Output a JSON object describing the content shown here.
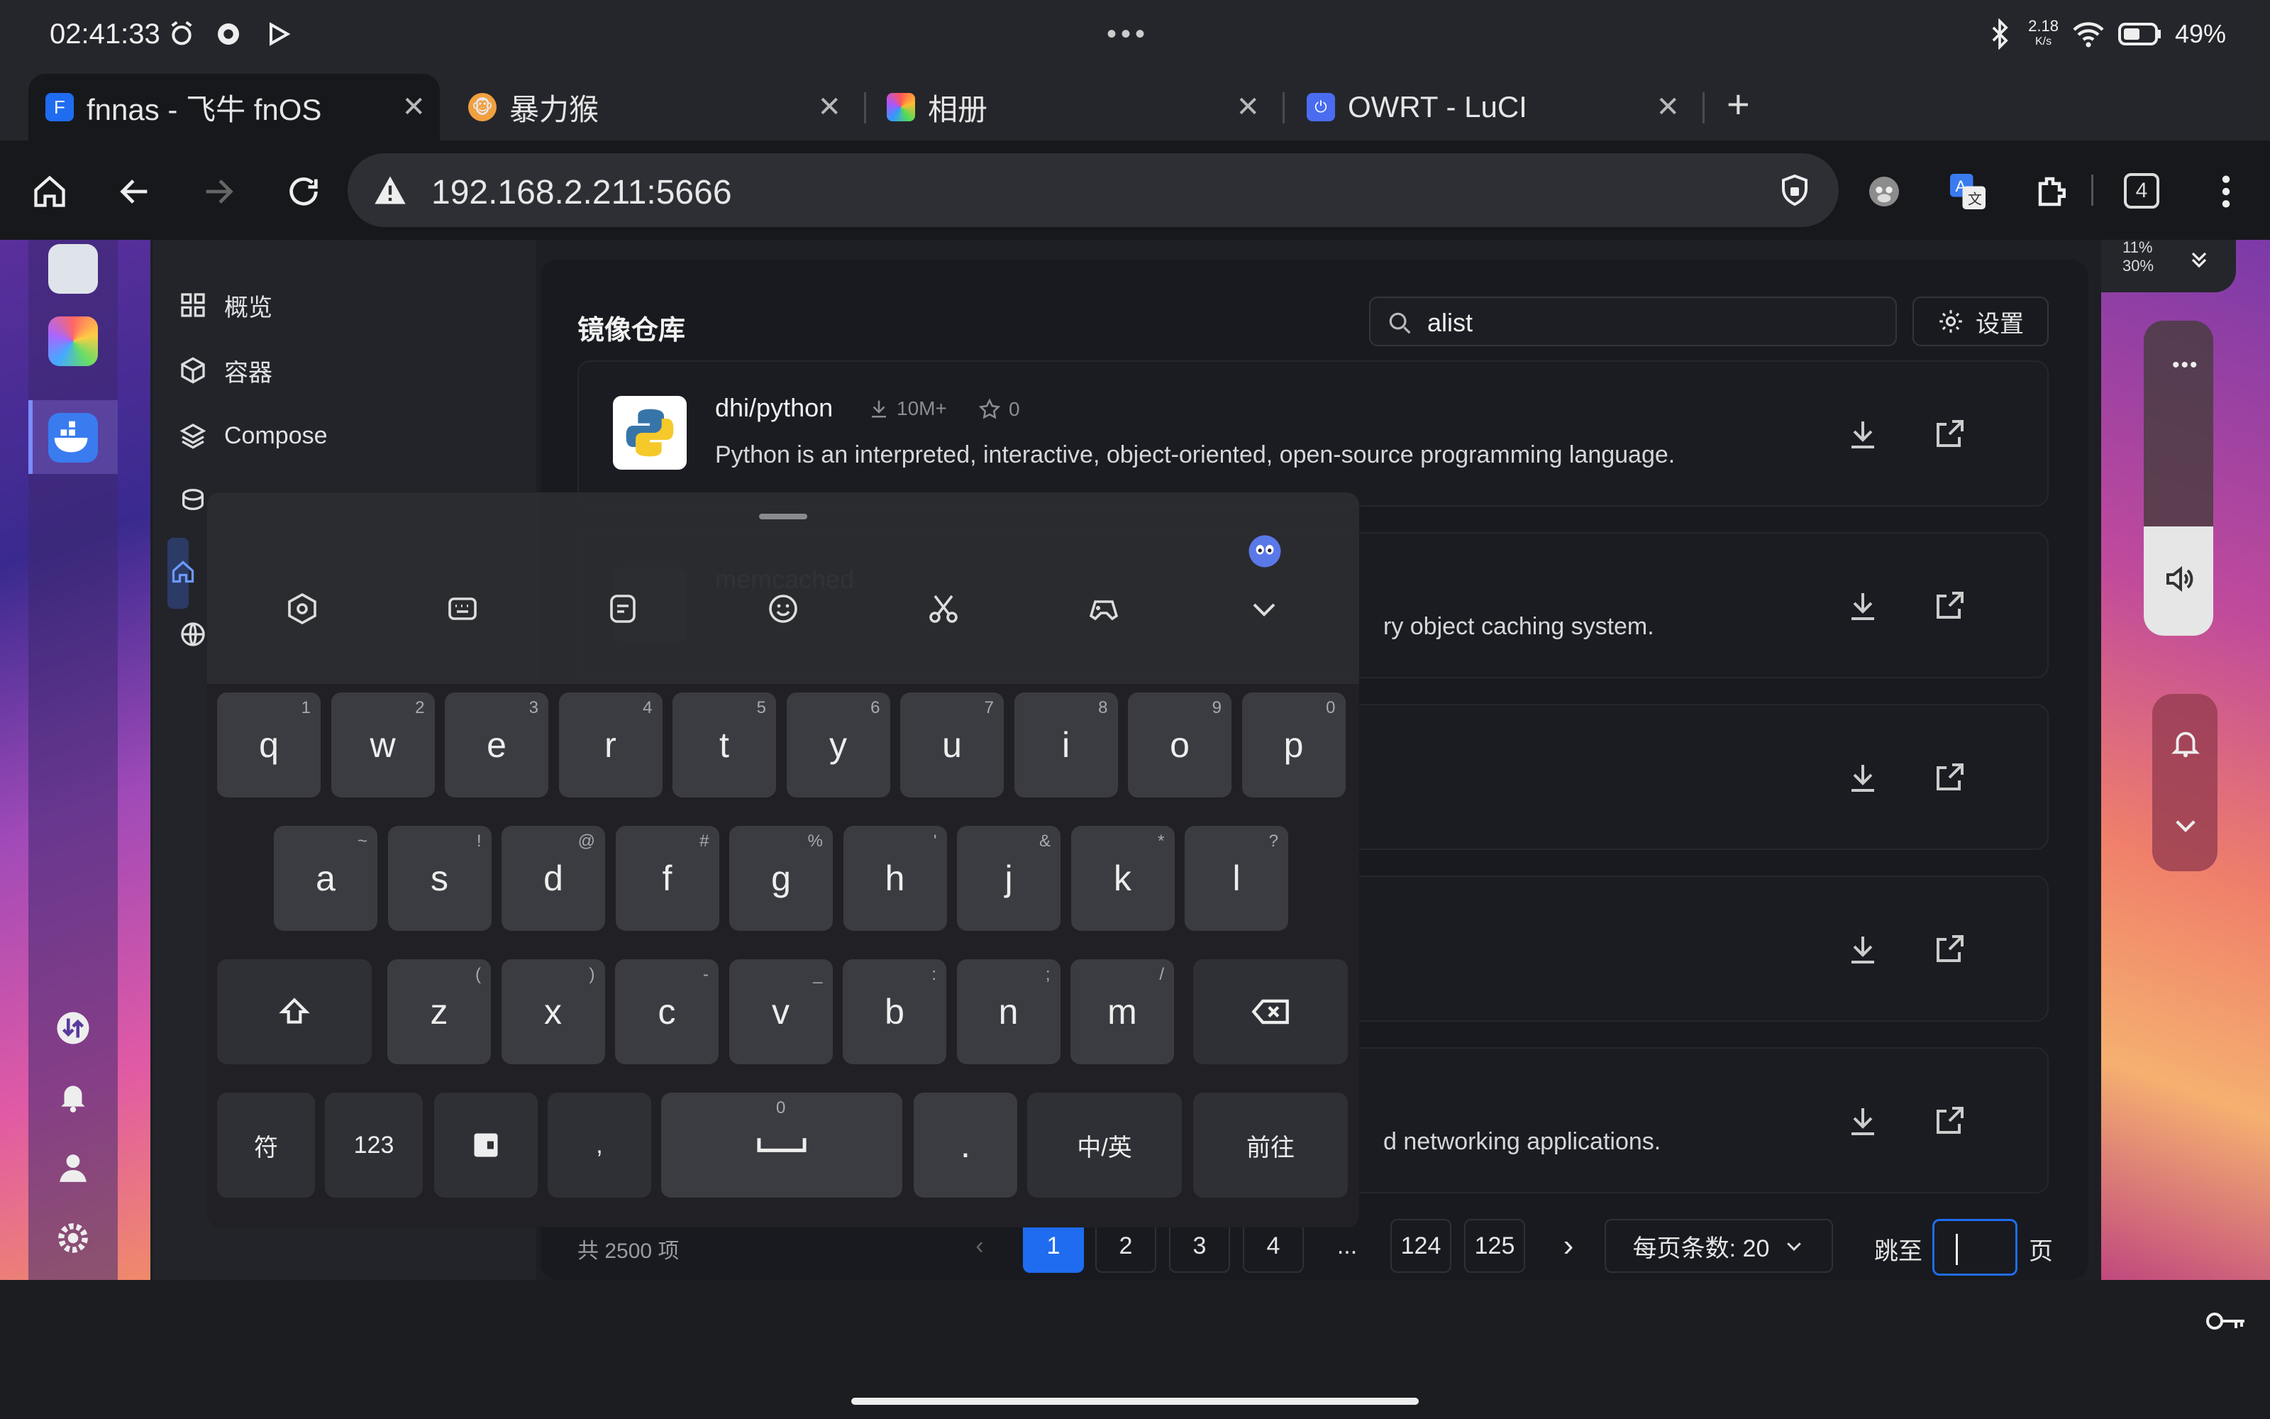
{
  "status_bar": {
    "time": "02:41:33",
    "net_speed_value": "2.18",
    "net_speed_unit": "K/s",
    "battery": "49%"
  },
  "tabs": [
    {
      "title": "fnnas - 飞牛 fnOS",
      "active": true
    },
    {
      "title": "暴力猴",
      "active": false
    },
    {
      "title": "相册",
      "active": false
    },
    {
      "title": "OWRT - LuCI",
      "active": false
    }
  ],
  "toolbar": {
    "url": "192.168.2.211:5666",
    "tab_count": "4"
  },
  "sidebar": {
    "items": [
      {
        "label": "概览"
      },
      {
        "label": "容器"
      },
      {
        "label": "Compose"
      }
    ]
  },
  "repo_panel": {
    "title": "镜像仓库",
    "search_value": "alist",
    "settings_label": "设置",
    "repos": [
      {
        "name": "dhi/python",
        "downloads": "10M+",
        "stars": "0",
        "description": "Python is an interpreted, interactive, object-oriented, open-source programming language."
      },
      {
        "name": "memcached",
        "downloads": "",
        "stars": "",
        "description": "ry object caching system."
      },
      {
        "name": "",
        "downloads": "",
        "stars": "",
        "description": ""
      },
      {
        "name": "",
        "downloads": "",
        "stars": "",
        "description": ""
      },
      {
        "name": "",
        "downloads": "",
        "stars": "",
        "description": "d networking applications."
      }
    ]
  },
  "pagination": {
    "total": "共 2500 项",
    "pages": [
      "1",
      "2",
      "3",
      "4",
      "...",
      "124",
      "125"
    ],
    "current": "1",
    "per_page": "每页条数: 20",
    "jump_label": "跳至",
    "jump_suffix": "页"
  },
  "keyboard": {
    "row1": [
      [
        "q",
        "1"
      ],
      [
        "w",
        "2"
      ],
      [
        "e",
        "3"
      ],
      [
        "r",
        "4"
      ],
      [
        "t",
        "5"
      ],
      [
        "y",
        "6"
      ],
      [
        "u",
        "7"
      ],
      [
        "i",
        "8"
      ],
      [
        "o",
        "9"
      ],
      [
        "p",
        "0"
      ]
    ],
    "row2": [
      [
        "a",
        "~"
      ],
      [
        "s",
        "!"
      ],
      [
        "d",
        "@"
      ],
      [
        "f",
        "#"
      ],
      [
        "g",
        "%"
      ],
      [
        "h",
        "'"
      ],
      [
        "j",
        "&"
      ],
      [
        "k",
        "*"
      ],
      [
        "l",
        "?"
      ]
    ],
    "row3": [
      [
        "z",
        "("
      ],
      [
        "x",
        ")"
      ],
      [
        "c",
        "-"
      ],
      [
        "v",
        "_"
      ],
      [
        "b",
        ":"
      ],
      [
        "n",
        ";"
      ],
      [
        "m",
        "/"
      ]
    ],
    "symbol_key": "符",
    "number_key": "123",
    "comma_key": ",",
    "period_key": ".",
    "lang_key": "中/英",
    "go_key": "前往",
    "space_hint": "0"
  },
  "right_panel": {
    "cpu_mem": "11%\n30%"
  },
  "colors": {
    "accent": "#1f6cf0",
    "panel_bg": "#181a1f"
  }
}
